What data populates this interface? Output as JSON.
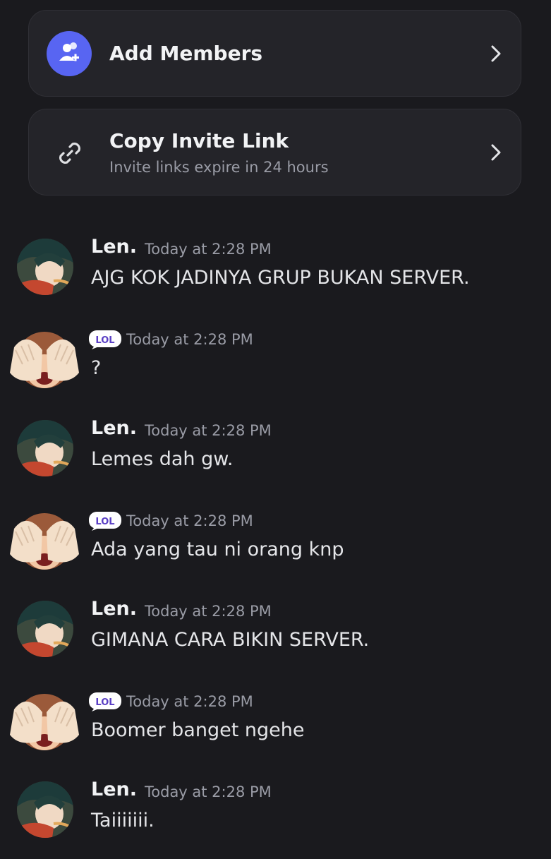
{
  "actions": {
    "add_members": {
      "label": "Add Members",
      "icon": "add-user-icon"
    },
    "copy_invite": {
      "label": "Copy Invite Link",
      "subtitle": "Invite links expire in 24 hours",
      "icon": "link-icon"
    }
  },
  "colors": {
    "background": "#1a1a1e",
    "card": "#242429",
    "accent": "#5865f2",
    "muted": "#9a9ca6"
  },
  "messages": [
    {
      "author": "Len.",
      "badge": "",
      "timestamp": "Today at 2:28 PM",
      "text": "AJG KOK JADINYA GRUP BUKAN SERVER."
    },
    {
      "author": "",
      "badge": "LOL",
      "timestamp": "Today at 2:28 PM",
      "text": "?"
    },
    {
      "author": "Len.",
      "badge": "",
      "timestamp": "Today at 2:28 PM",
      "text": "Lemes dah gw."
    },
    {
      "author": "",
      "badge": "LOL",
      "timestamp": "Today at 2:28 PM",
      "text": "Ada yang tau ni orang knp"
    },
    {
      "author": "Len.",
      "badge": "",
      "timestamp": "Today at 2:28 PM",
      "text": "GIMANA CARA BIKIN SERVER."
    },
    {
      "author": "",
      "badge": "LOL",
      "timestamp": "Today at 2:28 PM",
      "text": "Boomer banget ngehe"
    },
    {
      "author": "Len.",
      "badge": "",
      "timestamp": "Today at 2:28 PM",
      "text": "Taiiiiiii."
    }
  ]
}
